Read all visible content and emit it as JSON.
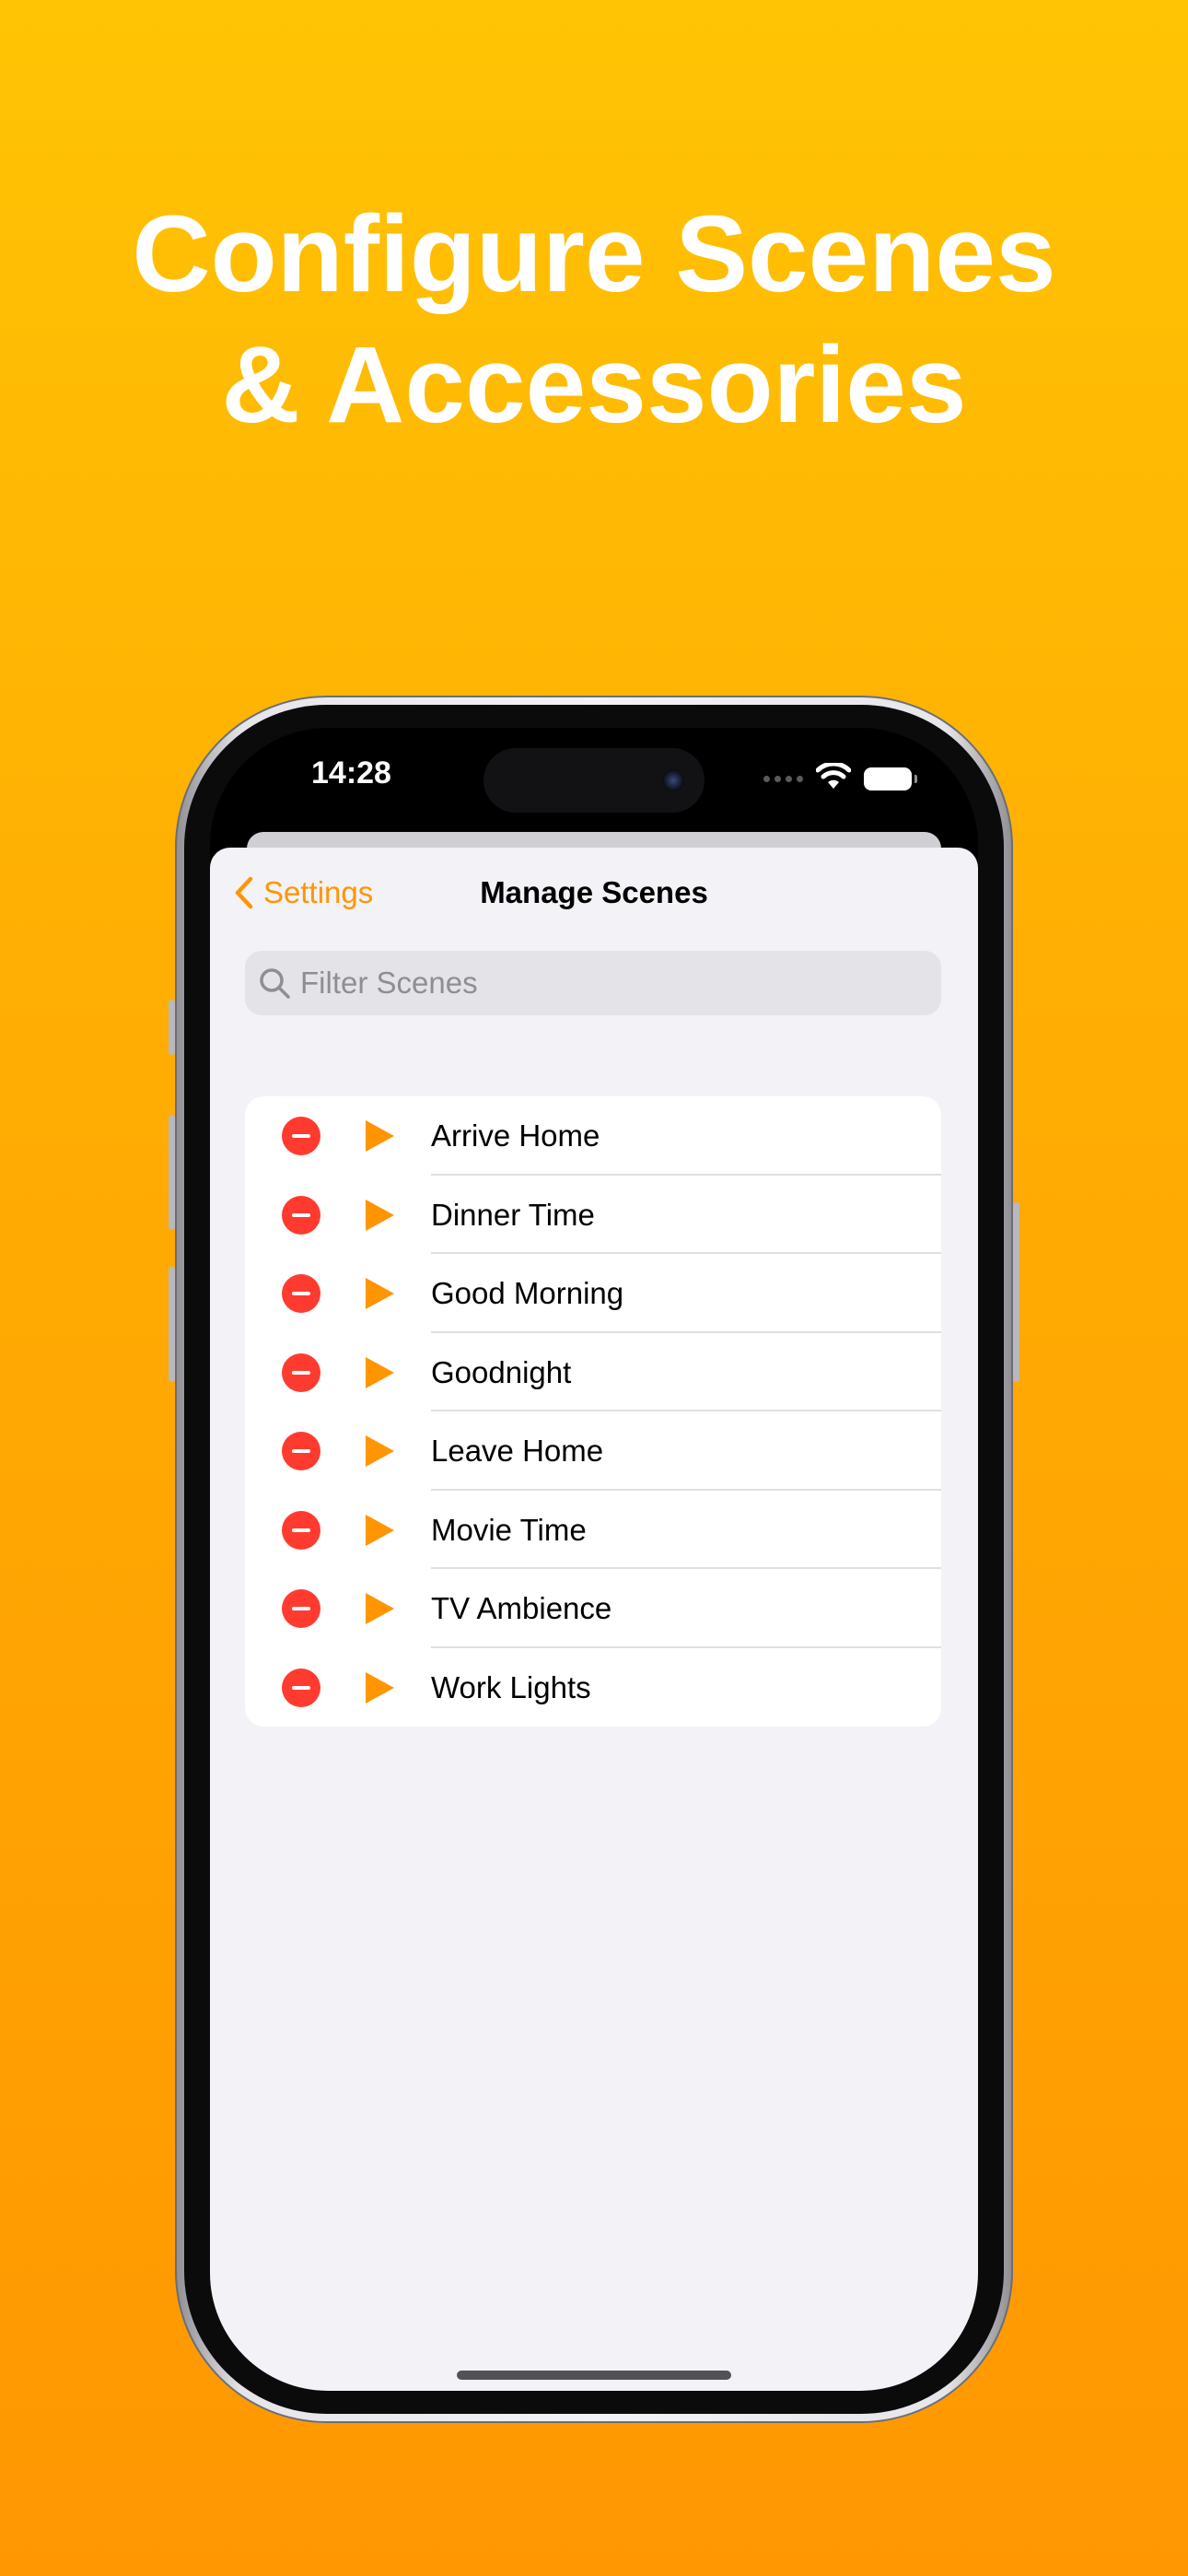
{
  "headline": {
    "line1": "Configure Scenes",
    "line2": "& Accessories"
  },
  "status_bar": {
    "time": "14:28",
    "icons": [
      "cellular-dots-icon",
      "wifi-icon",
      "battery-icon"
    ]
  },
  "nav": {
    "back_label": "Settings",
    "title": "Manage Scenes"
  },
  "search": {
    "placeholder": "Filter Scenes",
    "value": ""
  },
  "scenes": [
    {
      "name": "Arrive Home"
    },
    {
      "name": "Dinner Time"
    },
    {
      "name": "Good Morning"
    },
    {
      "name": "Goodnight"
    },
    {
      "name": "Leave Home"
    },
    {
      "name": "Movie Time"
    },
    {
      "name": "TV Ambience"
    },
    {
      "name": "Work Lights"
    }
  ],
  "colors": {
    "accent": "#ff9500",
    "delete": "#ff3b30",
    "background_top": "#ffc404",
    "background_bottom": "#ff9702"
  }
}
